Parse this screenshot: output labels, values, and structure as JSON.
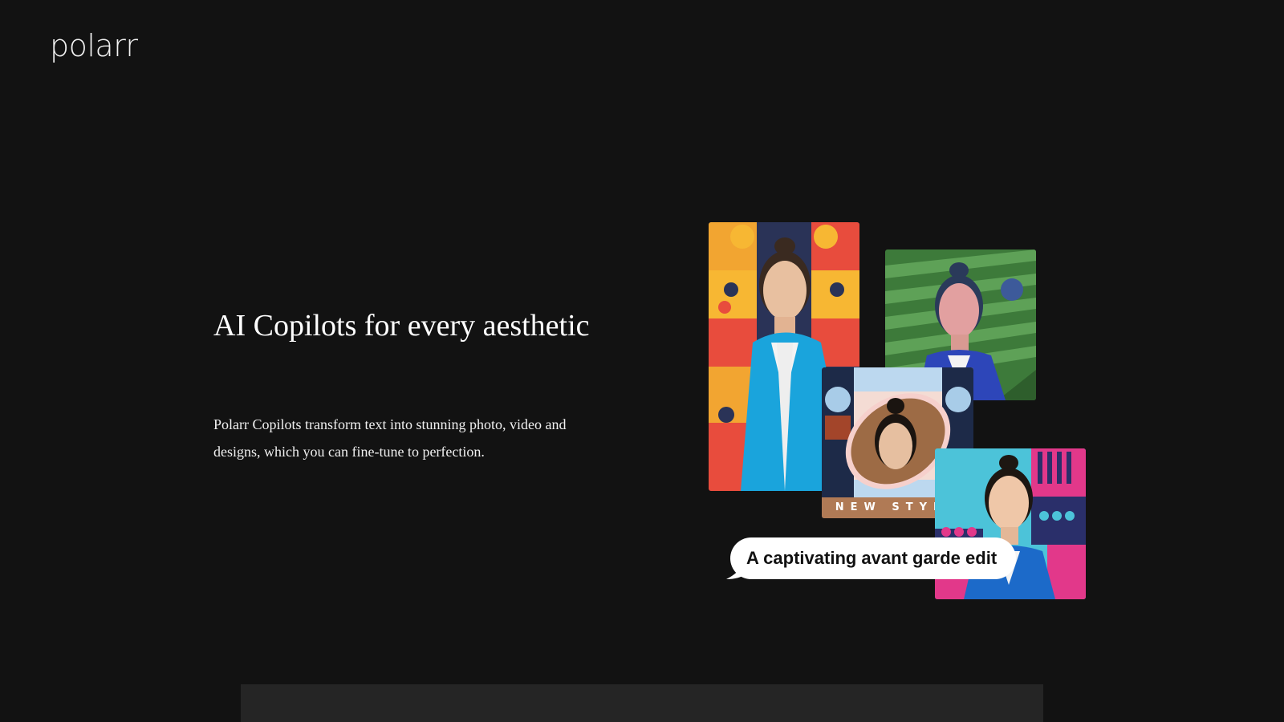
{
  "header": {
    "logo_text": "polarr"
  },
  "hero": {
    "headline": "AI Copilots for every aesthetic",
    "description": "Polarr Copilots transform text into stunning photo, video and designs, which you can fine-tune to perfection."
  },
  "collage": {
    "style_label": "NEW STYLE",
    "prompt_bubble": "A captivating avant garde edit"
  },
  "colors": {
    "background": "#121212",
    "panel": "#252525",
    "text": "#ffffff",
    "style_label_bg": "#b07a55"
  }
}
